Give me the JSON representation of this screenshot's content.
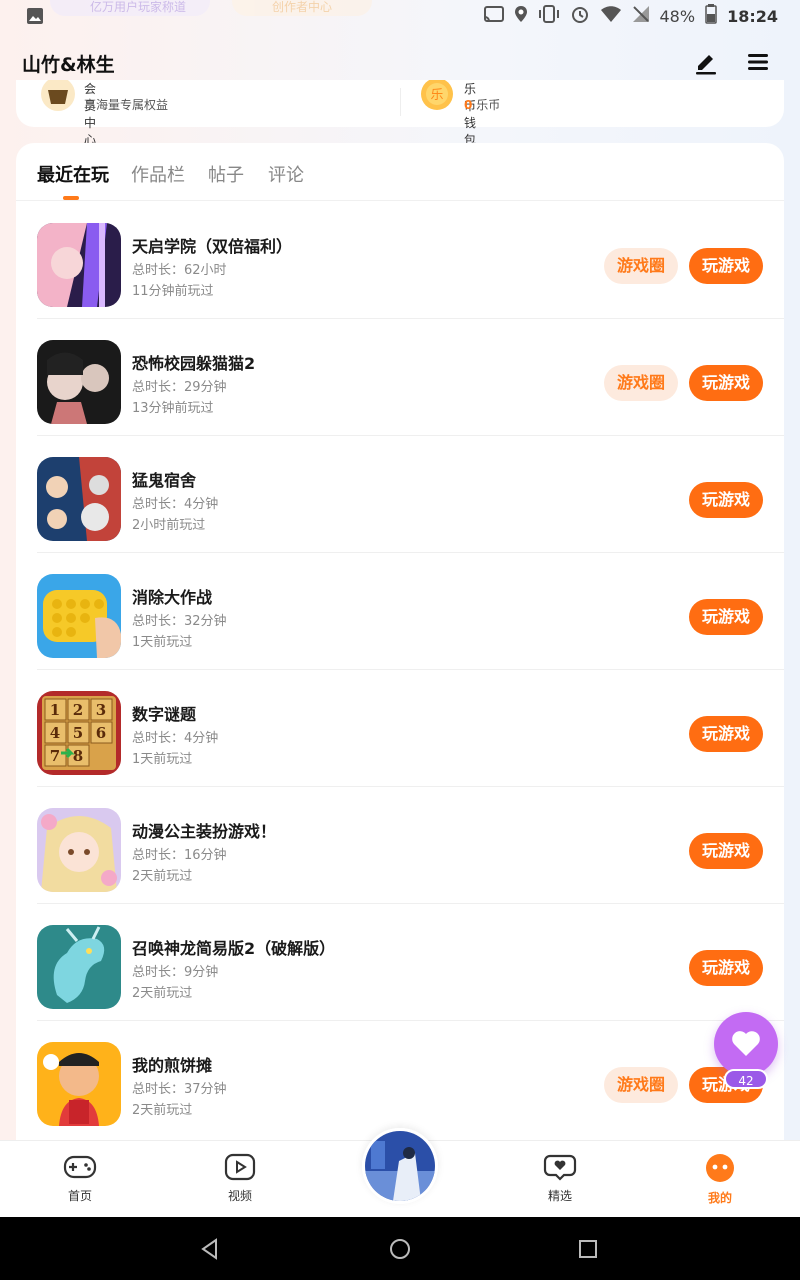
{
  "status_bar": {
    "battery": "48%",
    "time": "18:24",
    "peek_left": "亿万用户玩家称道",
    "peek_right": "创作者中心"
  },
  "header": {
    "title": "山竹&林生"
  },
  "wallet": {
    "member": {
      "title": "会员中心",
      "subtitle": "享海量专属权益"
    },
    "coins": {
      "title": "乐币钱包",
      "amount": "0",
      "unit": "乐币"
    }
  },
  "tabs": [
    "最近在玩",
    "作品栏",
    "帖子",
    "评论"
  ],
  "games": [
    {
      "name": "天启学院（双倍福利）",
      "duration": "总时长：62小时",
      "last_played": "11分钟前玩过",
      "has_circle": true
    },
    {
      "name": "恐怖校园躲猫猫2",
      "duration": "总时长：29分钟",
      "last_played": "13分钟前玩过",
      "has_circle": true
    },
    {
      "name": "猛鬼宿舍",
      "duration": "总时长：4分钟",
      "last_played": "2小时前玩过",
      "has_circle": false
    },
    {
      "name": "消除大作战",
      "duration": "总时长：32分钟",
      "last_played": "1天前玩过",
      "has_circle": false
    },
    {
      "name": "数字谜题",
      "duration": "总时长：4分钟",
      "last_played": "1天前玩过",
      "has_circle": false
    },
    {
      "name": "动漫公主装扮游戏！",
      "duration": "总时长：16分钟",
      "last_played": "2天前玩过",
      "has_circle": false
    },
    {
      "name": "召唤神龙简易版2（破解版）",
      "duration": "总时长：9分钟",
      "last_played": "2天前玩过",
      "has_circle": false
    },
    {
      "name": "我的煎饼摊",
      "duration": "总时长：37分钟",
      "last_played": "2天前玩过",
      "has_circle": true
    }
  ],
  "buttons": {
    "circle_label": "游戏圈",
    "play_label": "玩游戏"
  },
  "fab": {
    "badge": "42"
  },
  "bottom_nav": [
    {
      "label": "首页",
      "icon": "gamepad-icon"
    },
    {
      "label": "视频",
      "icon": "play-icon"
    },
    {
      "label": "精选",
      "icon": "heart-chat-icon"
    },
    {
      "label": "我的",
      "icon": "face-icon"
    }
  ],
  "colors": {
    "accent": "#ff6d12",
    "accent_light": "#fdeade",
    "fab": "#c36bf3"
  }
}
